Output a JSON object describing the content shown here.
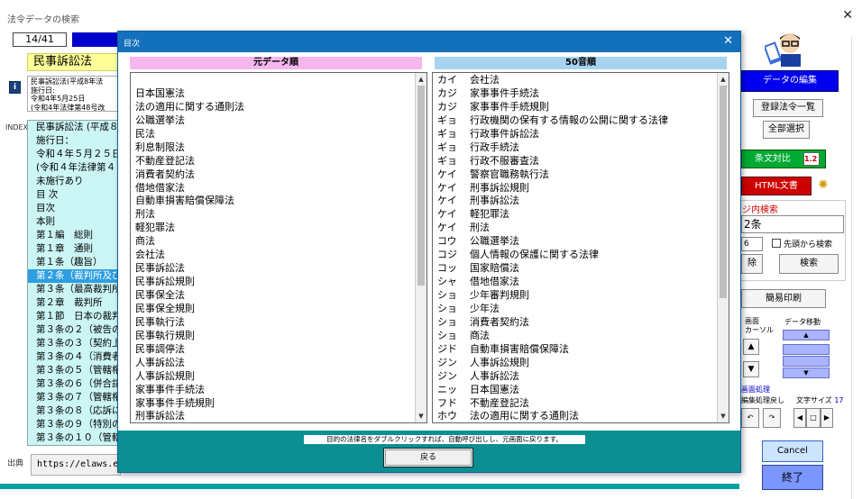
{
  "window": {
    "title": "法令データの検索",
    "close_glyph": "✕"
  },
  "counter": "14/41",
  "law_name": "民事訴訟法",
  "info_icon": "info-icon",
  "info_lines": [
    "民事訴訟法(平成8年法",
    "施行日:",
    "令和4年5月25日",
    "(令和4年法律第48号改"
  ],
  "index_label": "INDEX",
  "index_items": [
    "民事訴訟法 (平成８",
    "施行日：",
    "令和４年５月２５日",
    "(令和４年法律第４",
    "未施行あり",
    "目 次",
    "目次",
    "本則",
    "第１編　総則",
    "第１章　通則",
    "第１条（趣旨）",
    "第２条（裁判所及び",
    "第３条（最高裁判所",
    "第２章　裁判所",
    "第１節　日本の裁判",
    "第３条の２（被告の",
    "第３条の３（契約上",
    "第３条の４（消費者",
    "第３条の５（管轄権",
    "第３条の６（併合請",
    "第３条の７（管轄権",
    "第３条の８（応訴に",
    "第３条の９（特別の",
    "第３条の１０（管轄"
  ],
  "index_selected": 11,
  "source": {
    "label": "出典",
    "value": "https://elaws.e-go"
  },
  "right_panel": {
    "edit_button": "データの編集",
    "law_list_button": "登録法令一覧",
    "select_all_button": "全部選択",
    "compare_button": "条文対比",
    "compare_num": "1.2",
    "html_button": "HTML文書",
    "bulb_icon": "lightbulb-icon",
    "search_title": "ジ内検索",
    "search_value": "2条",
    "search_num": "6",
    "prefix_label": "先頭から検索",
    "clear_button": "除",
    "search_button": "検索",
    "print_button": "簡易印刷",
    "screen_label": "画面",
    "cursor_label": "カーソル",
    "data_move_label": "データ移動",
    "up_glyph": "▲",
    "down_glyph": "▼",
    "screen_proc_label": "画面処理",
    "edit_undo_label": "編集処理戻し",
    "font_size_label": "文字サイズ",
    "font_size_value": "17",
    "undo_glyph": "↶",
    "redo_glyph": "↷",
    "font_prev": "◀",
    "font_box": "□",
    "font_next": "▶",
    "cancel_button": "Cancel",
    "end_button": "終了"
  },
  "dialog": {
    "title": "目次",
    "close_glyph": "✕",
    "left_header": "元データ順",
    "right_header": "50音順",
    "left_items": [
      "",
      "日本国憲法",
      "法の適用に関する通則法",
      "公職選挙法",
      "民法",
      "利息制限法",
      "不動産登記法",
      "消費者契約法",
      "借地借家法",
      "自動車損害賠償保障法",
      "刑法",
      "軽犯罪法",
      "商法",
      "会社法",
      "民事訴訟法",
      "民事訴訟規則",
      "民事保全法",
      "民事保全規則",
      "民事執行法",
      "民事執行規則",
      "民事調停法",
      "人事訴訟法",
      "人事訴訟規則",
      "家事事件手続法",
      "家事事件手続規則",
      "刑事訴訟法"
    ],
    "right_items": [
      {
        "kana": "カイ",
        "name": "会社法"
      },
      {
        "kana": "カジ",
        "name": "家事事件手続法"
      },
      {
        "kana": "カジ",
        "name": "家事事件手続規則"
      },
      {
        "kana": "ギョ",
        "name": "行政機関の保有する情報の公開に関する法律"
      },
      {
        "kana": "ギョ",
        "name": "行政事件訴訟法"
      },
      {
        "kana": "ギョ",
        "name": "行政手続法"
      },
      {
        "kana": "ギョ",
        "name": "行政不服審査法"
      },
      {
        "kana": "ケイ",
        "name": "警察官職務執行法"
      },
      {
        "kana": "ケイ",
        "name": "刑事訴訟規則"
      },
      {
        "kana": "ケイ",
        "name": "刑事訴訟法"
      },
      {
        "kana": "ケイ",
        "name": "軽犯罪法"
      },
      {
        "kana": "ケイ",
        "name": "刑法"
      },
      {
        "kana": "コウ",
        "name": "公職選挙法"
      },
      {
        "kana": "コジ",
        "name": "個人情報の保護に関する法律"
      },
      {
        "kana": "コッ",
        "name": "国家賠償法"
      },
      {
        "kana": "シャ",
        "name": "借地借家法"
      },
      {
        "kana": "ショ",
        "name": "少年審判規則"
      },
      {
        "kana": "ショ",
        "name": "少年法"
      },
      {
        "kana": "ショ",
        "name": "消費者契約法"
      },
      {
        "kana": "ショ",
        "name": "商法"
      },
      {
        "kana": "ジド",
        "name": "自動車損害賠償保障法"
      },
      {
        "kana": "ジン",
        "name": "人事訴訟規則"
      },
      {
        "kana": "ジン",
        "name": "人事訴訟法"
      },
      {
        "kana": "ニッ",
        "name": "日本国憲法"
      },
      {
        "kana": "フド",
        "name": "不動産登記法"
      },
      {
        "kana": "ホウ",
        "name": "法の適用に関する通則法"
      }
    ],
    "scroll_up_glyph": "▲",
    "scroll_down_glyph": "▼",
    "hint": "目的の法律名をダブルクリックすれば、自動呼び出しし、元画面に戻ります。",
    "back_button": "戻る"
  },
  "colors": {
    "dialog_title_bar": "#1370bd",
    "left_header_bg": "#f6b6ee",
    "right_header_bg": "#a6d4f0",
    "footer_bg": "#0b8f92",
    "index_bg": "#ccf5f5",
    "index_selected_bg": "#2e9ee0"
  }
}
